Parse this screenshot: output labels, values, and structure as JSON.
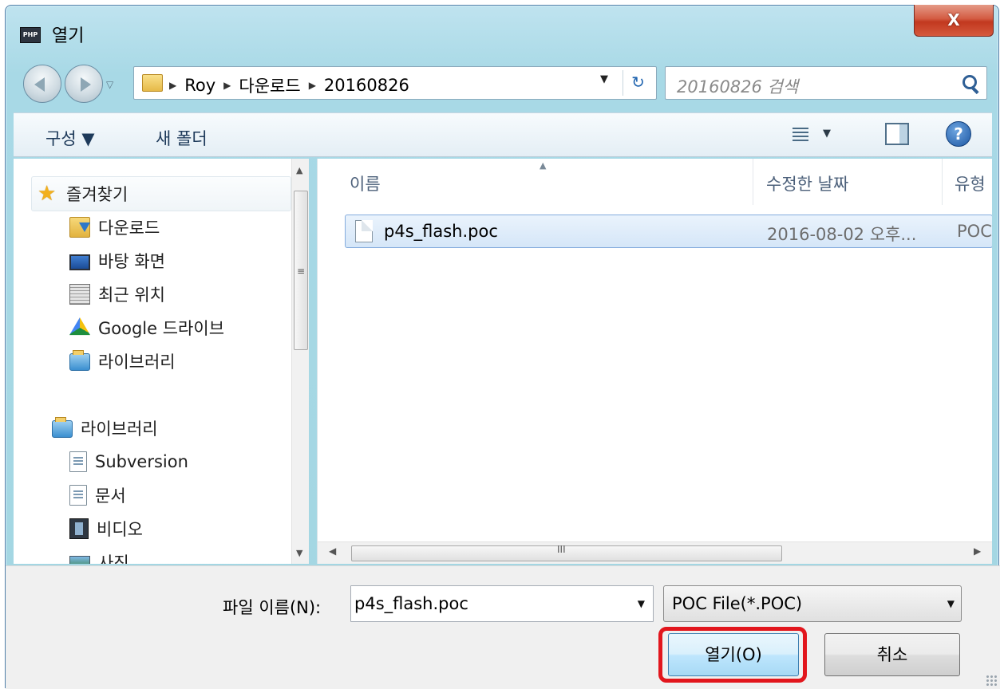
{
  "window": {
    "title": "열기",
    "app_icon_text": "PHP",
    "close_label": "X"
  },
  "nav": {
    "recent_arrow": "▽",
    "breadcrumbs": [
      "Roy",
      "다운로드",
      "20160826"
    ],
    "crumb_separator": "▶",
    "dropdown_arrow": "▼",
    "refresh_glyph": "↻"
  },
  "search": {
    "placeholder": "20160826 검색"
  },
  "toolbar": {
    "organize_label": "구성 ▼",
    "new_folder_label": "새 폴더",
    "views_arrow": "▼",
    "help_label": "?"
  },
  "sidebar": {
    "favorites_label": "즐겨찾기",
    "favorites_items": [
      "다운로드",
      "바탕 화면",
      "최근 위치",
      "Google 드라이브",
      "라이브러리"
    ],
    "libraries_label": "라이브러리",
    "libraries_items": [
      "Subversion",
      "문서",
      "비디오",
      "사진"
    ],
    "scroll_up": "▲",
    "scroll_down": "▼",
    "scroll_grip": "≡"
  },
  "file_list": {
    "columns": [
      "이름",
      "수정한 날짜",
      "유형"
    ],
    "sort_indicator": "▲",
    "rows": [
      {
        "name": "p4s_flash.poc",
        "date": "2016-08-02 오후...",
        "type": "POC"
      }
    ],
    "hscroll_left": "◀",
    "hscroll_right": "▶",
    "hscroll_grip": "III"
  },
  "footer": {
    "filename_label": "파일 이름(N):",
    "filename_value": "p4s_flash.poc",
    "filename_arrow": "▼",
    "filetype_value": "POC File(*.POC)",
    "filetype_arrow": "▼",
    "open_label": "열기(O)",
    "cancel_label": "취소"
  },
  "colors": {
    "highlight": "#e2161d",
    "selection": "#d5e6f8",
    "titlebar": "#a8d9e6"
  }
}
